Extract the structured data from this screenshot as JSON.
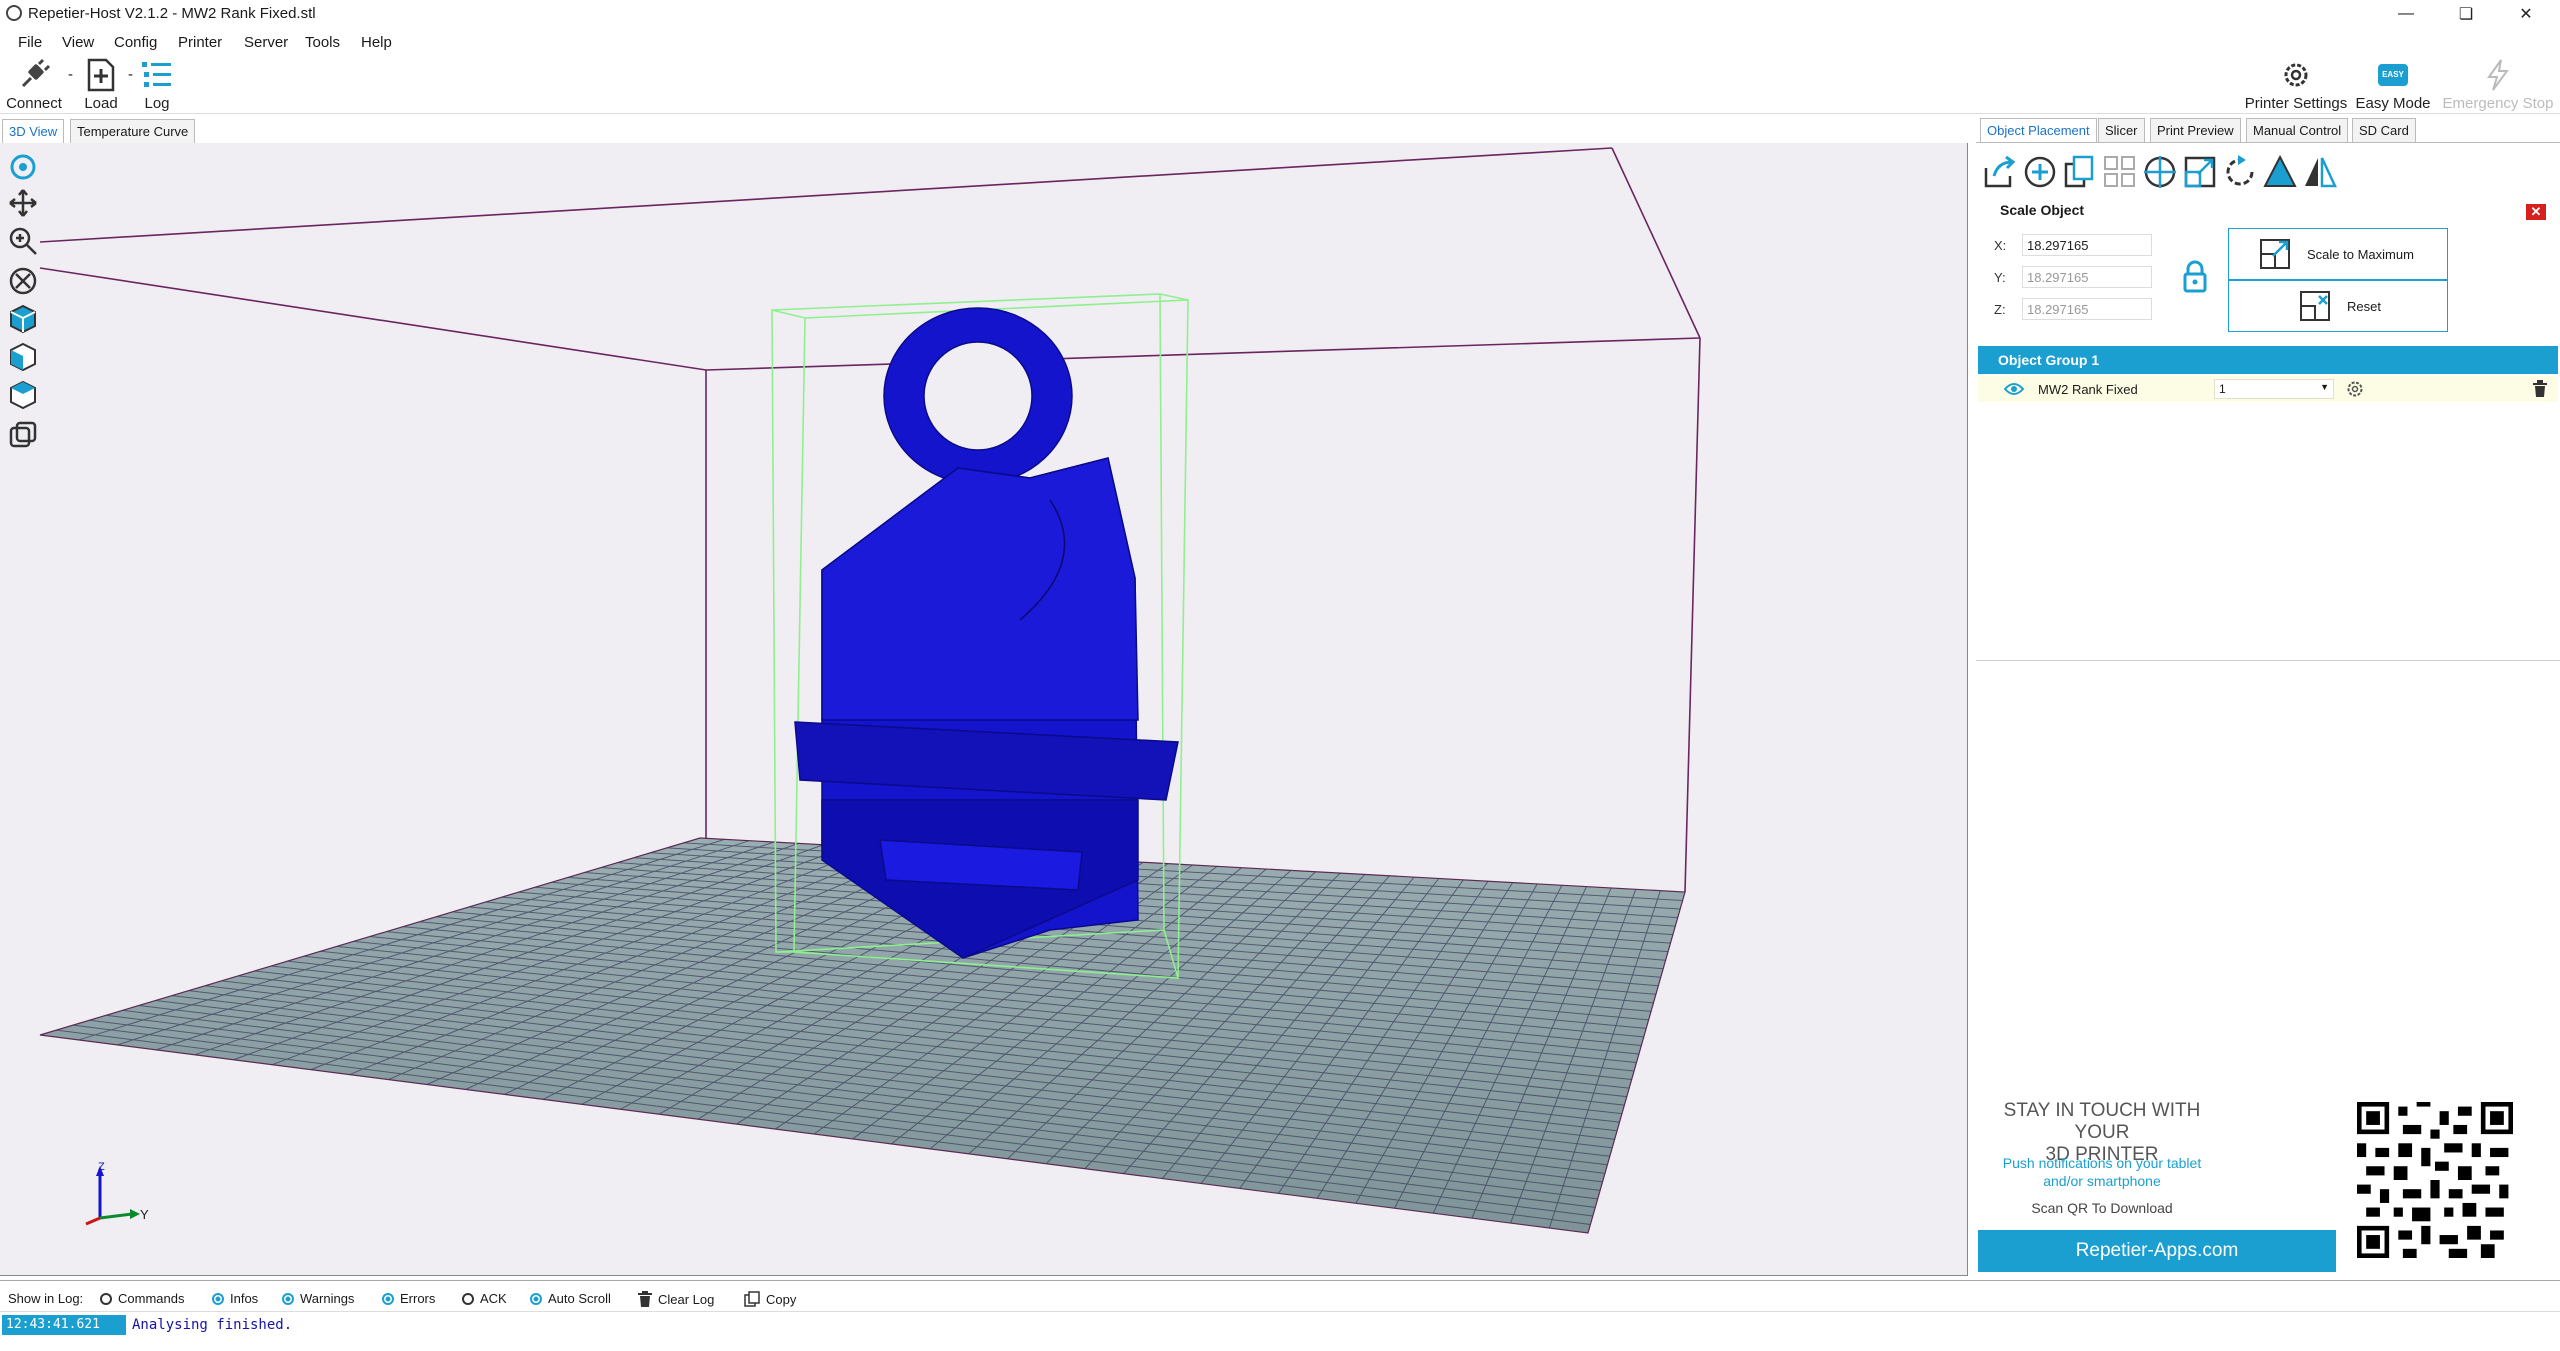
{
  "window": {
    "title": "Repetier-Host V2.1.2 - MW2 Rank Fixed.stl",
    "controls": [
      "minimize",
      "maximize",
      "close"
    ]
  },
  "menu": [
    "File",
    "View",
    "Config",
    "Printer",
    "Server",
    "Tools",
    "Help"
  ],
  "toolbar": {
    "connect": "Connect",
    "load": "Load",
    "log": "Log",
    "printer_settings": "Printer Settings",
    "easy_mode": "Easy Mode",
    "easy_badge": "EASY",
    "emergency_stop": "Emergency Stop"
  },
  "left_tabs": [
    "3D View",
    "Temperature Curve"
  ],
  "view_tools": [
    "rotate-icon",
    "move-icon",
    "zoom-icon",
    "fit-view-icon",
    "iso-view-icon",
    "front-view-icon",
    "top-view-icon",
    "toggle-views-icon"
  ],
  "right_tabs": [
    "Object Placement",
    "Slicer",
    "Print Preview",
    "Manual Control",
    "SD Card"
  ],
  "placement_tools": [
    "add-object-icon",
    "add-part-icon",
    "copy-objects-icon",
    "autoposition-icon",
    "center-object-icon",
    "scale-icon",
    "rotate-object-icon",
    "cut-icon",
    "mirror-icon"
  ],
  "scale": {
    "heading": "Scale Object",
    "x_label": "X:",
    "y_label": "Y:",
    "z_label": "Z:",
    "x": "18.297165",
    "y": "18.297165",
    "z": "18.297165",
    "scale_max_label": "Scale to Maximum",
    "reset_label": "Reset"
  },
  "object_group": {
    "title": "Object Group 1",
    "object_name": "MW2 Rank Fixed",
    "copies": "1"
  },
  "promo": {
    "headline_1": "STAY IN TOUCH WITH YOUR",
    "headline_2": "3D PRINTER",
    "sub_1": "Push notifications on your tablet",
    "sub_2": "and/or smartphone",
    "scan": "Scan QR To Download",
    "button": "Repetier-Apps.com"
  },
  "log": {
    "show_label": "Show in Log:",
    "options": [
      {
        "label": "Commands",
        "checked": false
      },
      {
        "label": "Infos",
        "checked": true
      },
      {
        "label": "Warnings",
        "checked": true
      },
      {
        "label": "Errors",
        "checked": true
      },
      {
        "label": "ACK",
        "checked": false
      },
      {
        "label": "Auto Scroll",
        "checked": true
      }
    ],
    "clear": "Clear Log",
    "copy": "Copy",
    "time": "12:43:41.621",
    "message": "Analysing finished."
  },
  "axes": {
    "z": "Z",
    "y": "Y"
  },
  "colors": {
    "accent": "#1a9fd0",
    "model": "#1010c8",
    "bed": "#8fa4a8",
    "frame": "#6b2560",
    "bbox": "#8ef08e"
  }
}
